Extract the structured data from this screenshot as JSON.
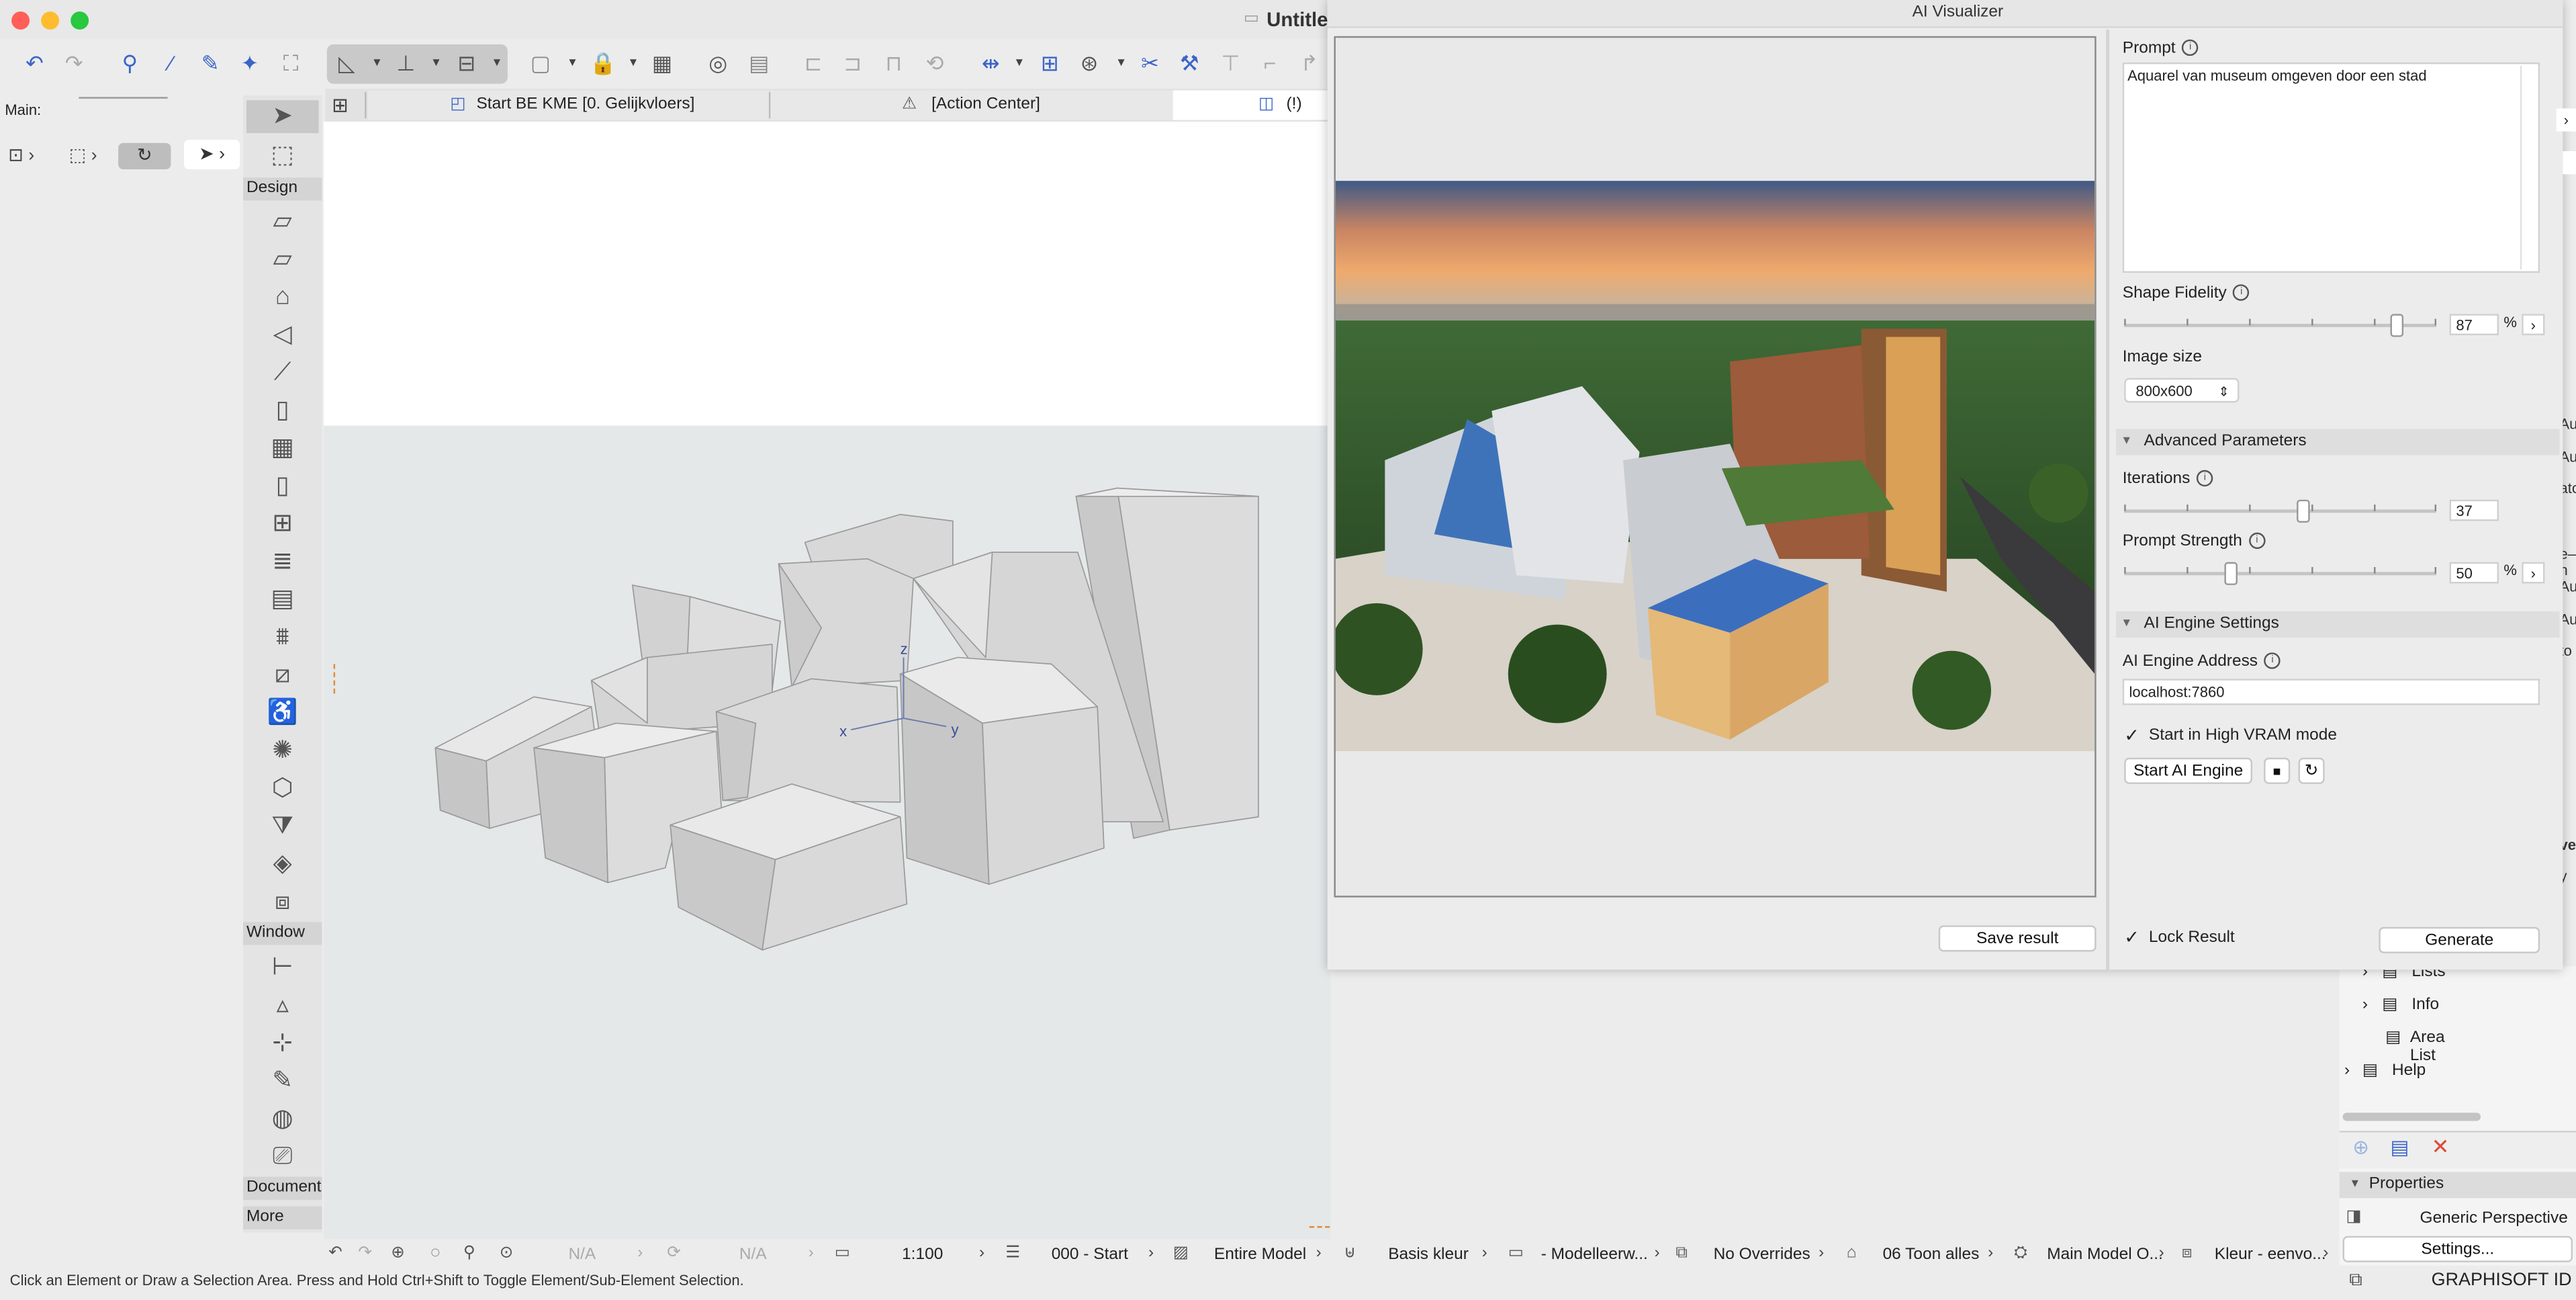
{
  "window": {
    "title": "Untitle",
    "traffic_lights": {
      "close": "#ff5f57",
      "minimize": "#febc2e",
      "zoom": "#28c840"
    }
  },
  "palette": {
    "main_label": "Main:",
    "sections": {
      "design": "Design",
      "window": "Window",
      "document": "Document",
      "more": "More"
    }
  },
  "tabs": [
    {
      "label": "Start BE KME [0. Gelijkvloers]"
    },
    {
      "label": "[Action Center]"
    },
    {
      "label": "(!) Sta"
    }
  ],
  "viewport": {
    "axes": {
      "x": "x",
      "y": "y",
      "z": "z"
    }
  },
  "status_bar": {
    "hint": "Click an Element or Draw a Selection Area. Press and Hold Ctrl+Shift to Toggle Element/Sub-Element Selection.",
    "items": {
      "na1": "N/A",
      "na2": "N/A",
      "scale": "1:100",
      "story": "000 - Start",
      "model": "Entire Model",
      "pen": "Basis kleur",
      "layer": "- Modelleerw...",
      "overrides": "No Overrides",
      "renovation": "06 Toon alles",
      "mvo": "Main Model O...",
      "color": "Kleur - eenvo..."
    }
  },
  "ai_visualizer": {
    "title": "AI Visualizer",
    "prompt_label": "Prompt",
    "prompt_value": "Aquarel van museum omgeven door een stad",
    "shape_fidelity_label": "Shape Fidelity",
    "shape_fidelity_value": "87",
    "shape_fidelity_fraction": 0.87,
    "percent_unit": "%",
    "image_size_label": "Image size",
    "image_size_value": "800x600",
    "advanced_label": "Advanced Parameters",
    "iterations_label": "Iterations",
    "iterations_value": "37",
    "prompt_strength_label": "Prompt Strength",
    "prompt_strength_value": "50",
    "engine_settings_label": "AI Engine Settings",
    "engine_address_label": "AI Engine Address",
    "engine_address_value": "localhost:7860",
    "high_vram_label": "Start in High VRAM mode",
    "start_engine_label": "Start AI Engine",
    "save_result_label": "Save result",
    "lock_result_label": "Lock Result",
    "generate_label": "Generate"
  },
  "navigator": {
    "items": [
      "Lists",
      "Info",
      "Area List",
      "Help"
    ],
    "properties_label": "Properties",
    "view_name": "Generic Perspective",
    "settings_label": "Settings...",
    "brand": "GRAPHISOFT ID"
  },
  "right_edge_fragments": [
    "Au",
    "Au",
    "ato",
    "e–n",
    "Au",
    "Au",
    "to",
    "ve",
    "y"
  ]
}
